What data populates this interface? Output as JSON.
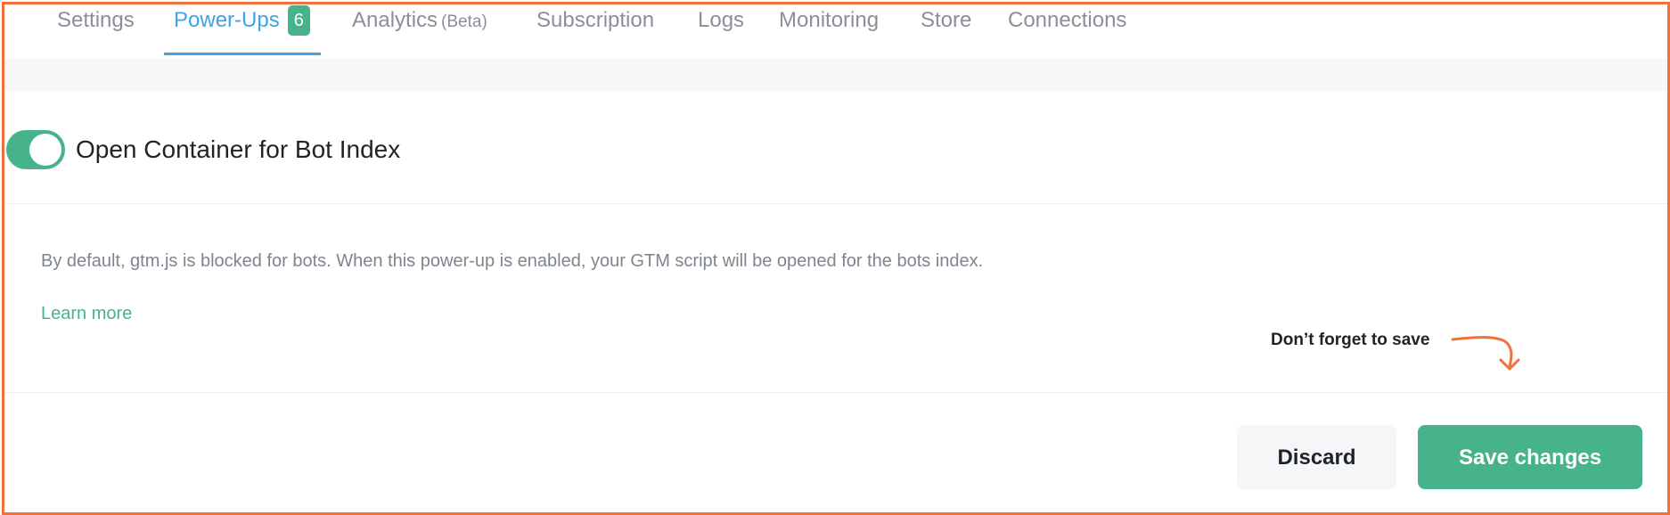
{
  "tabs": [
    {
      "label": "Settings"
    },
    {
      "label": "Power-Ups",
      "badge": "6",
      "active": true
    },
    {
      "label": "Analytics",
      "suffix": "(Beta)"
    },
    {
      "label": "Subscription"
    },
    {
      "label": "Logs"
    },
    {
      "label": "Monitoring"
    },
    {
      "label": "Store"
    },
    {
      "label": "Connections"
    }
  ],
  "powerup": {
    "title": "Open Container for Bot Index",
    "enabled": true,
    "description": "By default, gtm.js is blocked for bots. When this power-up is enabled, your GTM script will be opened for the bots index.",
    "learn_more": "Learn more"
  },
  "hint": "Don’t forget to save",
  "actions": {
    "discard": "Discard",
    "save": "Save changes"
  },
  "colors": {
    "accent_green": "#46b38b",
    "tab_active": "#3ea2e6",
    "frame": "#f0713a"
  }
}
